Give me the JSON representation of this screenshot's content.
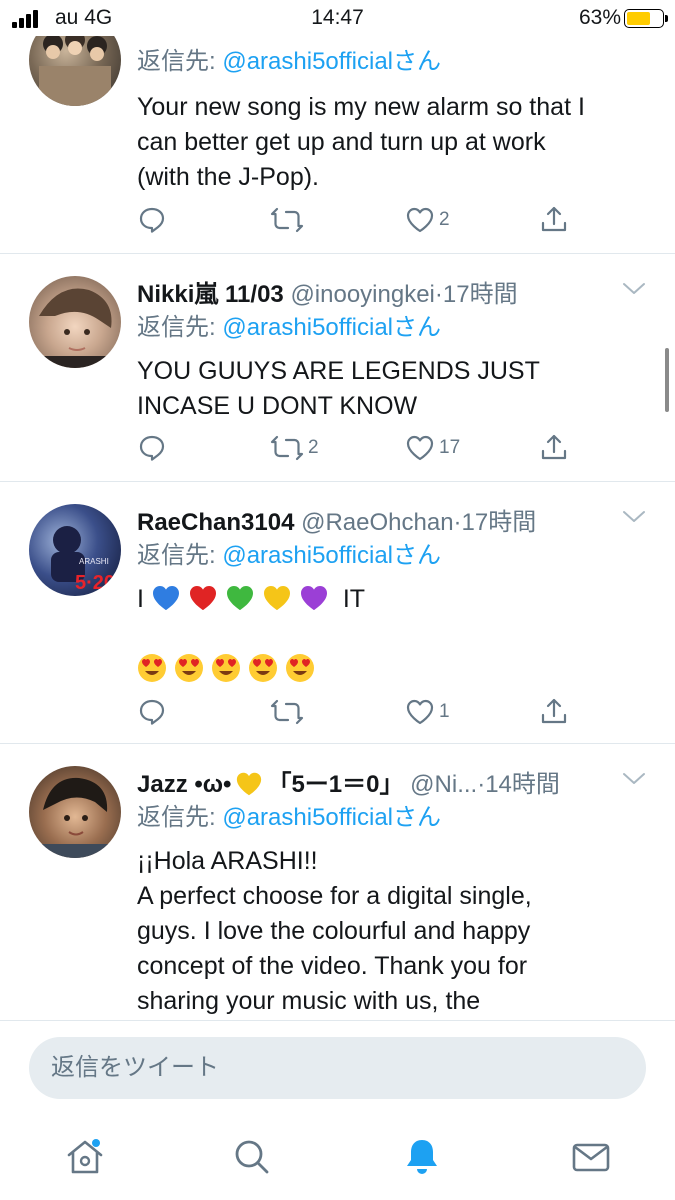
{
  "status_bar": {
    "carrier": "au 4G",
    "time": "14:47",
    "battery": "63%"
  },
  "tweets": [
    {
      "reply_prefix": "返信先: ",
      "reply_mention": "@arashi5officialさん",
      "lines": [
        "Your new song is my new alarm so that I",
        "can better get up and turn up at work",
        "(with the J-Pop)."
      ],
      "retweets": "",
      "likes": "2"
    },
    {
      "name": "Nikki嵐 11/03",
      "handle": "@inooyingkei",
      "sep": "·",
      "time": "17時間",
      "reply_prefix": "返信先: ",
      "reply_mention": "@arashi5officialさん",
      "lines": [
        "YOU GUUYS ARE LEGENDS JUST",
        "INCASE U DONT KNOW"
      ],
      "retweets": "2",
      "likes": "17"
    },
    {
      "name": "RaeChan3104",
      "handle": "@RaeOhchan",
      "sep": "·",
      "time": "17時間",
      "reply_prefix": "返信先: ",
      "reply_mention": "@arashi5officialさん",
      "line_start": "I",
      "line_end": "IT",
      "hearts": [
        "blue-heart",
        "red-heart",
        "green-heart",
        "yellow-heart",
        "purple-heart"
      ],
      "faces": [
        "heart-eyes-face",
        "heart-eyes-face",
        "heart-eyes-face",
        "heart-eyes-face",
        "heart-eyes-face"
      ],
      "retweets": "",
      "likes": "1"
    },
    {
      "name_start": "Jazz •ω•",
      "name_end": "「5ー1＝0」",
      "handle": "@Ni...",
      "sep": "·",
      "time": "14時間",
      "reply_prefix": "返信先: ",
      "reply_mention": "@arashi5officialさん",
      "lines": [
        "¡¡Hola ARASHI!!",
        "A perfect choose for a digital single,",
        "guys. I love the colourful and happy",
        "concept of the video. Thank you for",
        "sharing your music with us, the"
      ]
    }
  ],
  "composer": {
    "placeholder": "返信をツイート"
  },
  "tabs": [
    "home-icon",
    "search-icon",
    "notifications-icon",
    "messages-icon"
  ],
  "colors": {
    "accent": "#1da1f2",
    "text": "#14171a",
    "muted": "#657786",
    "divider": "#e1e8ed"
  }
}
